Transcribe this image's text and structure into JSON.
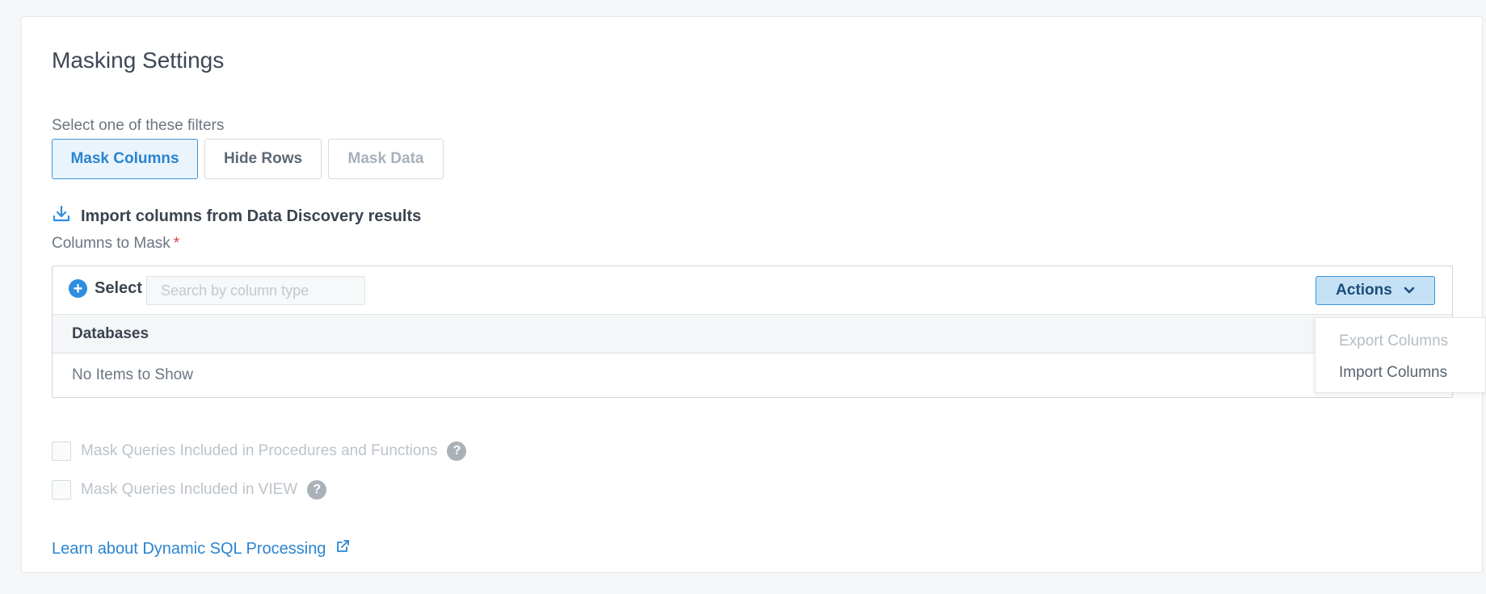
{
  "title": "Masking Settings",
  "filters": {
    "label": "Select one of these filters",
    "options": [
      {
        "label": "Mask Columns",
        "state": "active"
      },
      {
        "label": "Hide Rows",
        "state": "normal"
      },
      {
        "label": "Mask Data",
        "state": "disabled"
      }
    ]
  },
  "import_link": {
    "label": "Import columns from Data Discovery results",
    "icon": "download-icon"
  },
  "columns": {
    "label": "Columns to Mask",
    "required_mark": "*",
    "select_label": "Select",
    "search_placeholder": "Search by column type",
    "search_value": "",
    "actions_label": "Actions",
    "header": "Databases",
    "empty_text": "No Items to Show"
  },
  "actions_menu": {
    "items": [
      {
        "label": "Export Columns",
        "enabled": false
      },
      {
        "label": "Import Columns",
        "enabled": true
      }
    ]
  },
  "options": [
    {
      "label": "Mask Queries Included in Procedures and Functions",
      "checked": false,
      "disabled": true
    },
    {
      "label": "Mask Queries Included in VIEW",
      "checked": false,
      "disabled": true
    }
  ],
  "learn_link": {
    "label": "Learn about Dynamic SQL Processing",
    "icon": "external-link-icon"
  },
  "colors": {
    "accent": "#2a84cf",
    "required": "#d9413e",
    "actions_bg": "#c5e1f6"
  }
}
